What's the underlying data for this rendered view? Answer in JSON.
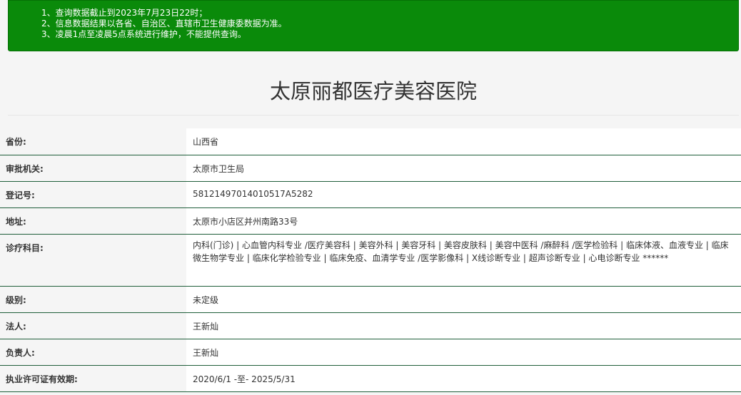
{
  "notice": {
    "lines": [
      "1、查询数据截止到2023年7月23日22时；",
      "2、信息数据结果以各省、自治区、直辖市卫生健康委数据为准。",
      "3、凌晨1点至凌晨5点系统进行维护，不能提供查询。"
    ]
  },
  "page_title": "太原丽都医疗美容医院",
  "rows": [
    {
      "label": "省份:",
      "value": "山西省"
    },
    {
      "label": "审批机关:",
      "value": "太原市卫生局"
    },
    {
      "label": "登记号:",
      "value": "58121497014010517A5282"
    },
    {
      "label": "地址:",
      "value": "太原市小店区并州南路33号"
    },
    {
      "label": "诊疗科目:",
      "value": "内科(门诊) | 心血管内科专业 /医疗美容科 | 美容外科 | 美容牙科 | 美容皮肤科 | 美容中医科 /麻醉科 /医学检验科 | 临床体液、血液专业 | 临床微生物学专业 | 临床化学检验专业 | 临床免疫、血清学专业 /医学影像科 | X线诊断专业 | 超声诊断专业 | 心电诊断专业 ******"
    },
    {
      "label": "级别:",
      "value": "未定级"
    },
    {
      "label": "法人:",
      "value": "王新灿"
    },
    {
      "label": "负责人:",
      "value": "王新灿"
    },
    {
      "label": "执业许可证有效期:",
      "value": "2020/6/1 -至- 2025/5/31"
    }
  ]
}
